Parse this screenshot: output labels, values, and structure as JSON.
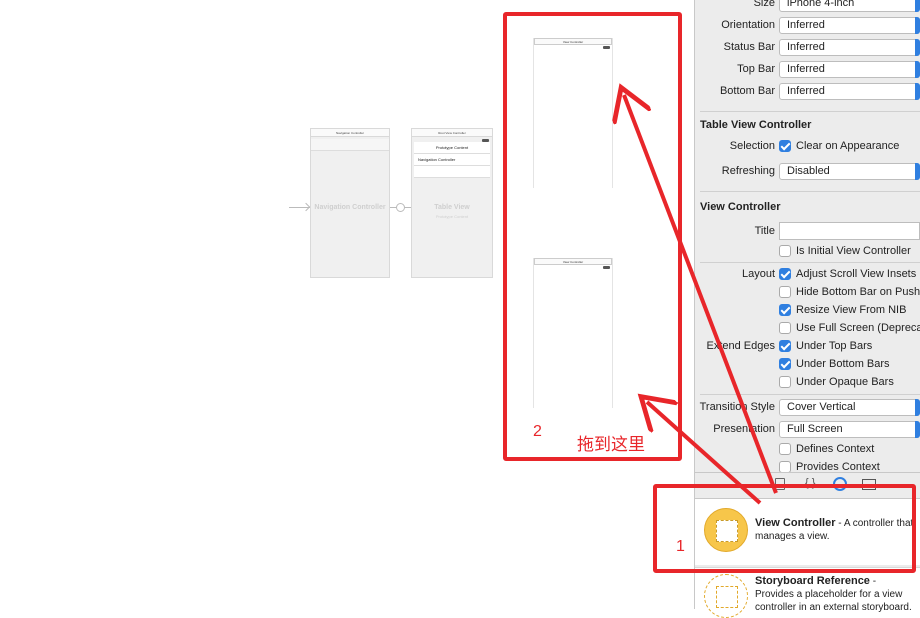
{
  "canvas": {
    "nav_controller": {
      "bar_title": "Navigation Controller",
      "center_label": "Navigation Controller"
    },
    "root_controller": {
      "bar_title": "Root View Controller",
      "cell_title": "Prototype Content",
      "cell_sub": "Navigation Controller",
      "center_label": "Table View",
      "center_sub": "Prototype Content"
    },
    "vc_top": {
      "bar_title": "View Controller"
    },
    "vc_bottom": {
      "bar_title": "View Controller"
    }
  },
  "inspector": {
    "simulated_metrics": [
      {
        "label": "Size",
        "value": "iPhone 4-inch"
      },
      {
        "label": "Orientation",
        "value": "Inferred"
      },
      {
        "label": "Status Bar",
        "value": "Inferred"
      },
      {
        "label": "Top Bar",
        "value": "Inferred"
      },
      {
        "label": "Bottom Bar",
        "value": "Inferred"
      }
    ],
    "table_view_controller": {
      "title": "Table View Controller",
      "selection_label": "Selection",
      "clear_on_appearance": "Clear on Appearance",
      "refreshing_label": "Refreshing",
      "refreshing_value": "Disabled"
    },
    "view_controller": {
      "title": "View Controller",
      "title_label": "Title",
      "is_initial": "Is Initial View Controller",
      "layout_label": "Layout",
      "layout_options": [
        {
          "text": "Adjust Scroll View Insets",
          "checked": true
        },
        {
          "text": "Hide Bottom Bar on Push",
          "checked": false
        },
        {
          "text": "Resize View From NIB",
          "checked": true
        },
        {
          "text": "Use Full Screen (Deprecated)",
          "checked": false
        }
      ],
      "extend_edges_label": "Extend Edges",
      "extend_options": [
        {
          "text": "Under Top Bars",
          "checked": true
        },
        {
          "text": "Under Bottom Bars",
          "checked": true
        },
        {
          "text": "Under Opaque Bars",
          "checked": false
        }
      ],
      "transition_label": "Transition Style",
      "transition_value": "Cover Vertical",
      "presentation_label": "Presentation",
      "presentation_value": "Full Screen",
      "defines_context": "Defines Context",
      "provides_context": "Provides Context"
    },
    "library": [
      {
        "title": "View Controller",
        "desc": " - A controller that manages a view."
      },
      {
        "title": "Storyboard Reference",
        "desc": " - Provides a placeholder for a view controller in an external storyboard."
      }
    ]
  },
  "annotations": {
    "label_1": "1",
    "label_2": "2",
    "drag_here": "拖到这里",
    "color": "#e8262a"
  }
}
